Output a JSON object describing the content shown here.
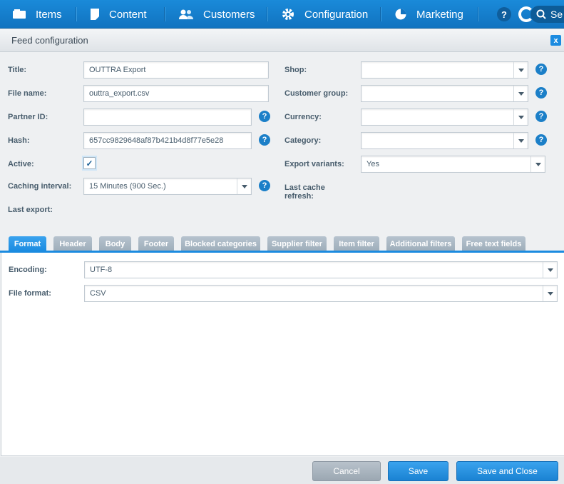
{
  "menu": {
    "items": [
      {
        "label": "Items",
        "icon": "items-icon"
      },
      {
        "label": "Content",
        "icon": "content-icon"
      },
      {
        "label": "Customers",
        "icon": "customers-icon"
      },
      {
        "label": "Configuration",
        "icon": "gear-icon"
      },
      {
        "label": "Marketing",
        "icon": "pie-chart-icon"
      }
    ],
    "help": "?",
    "search_text": "Se"
  },
  "window": {
    "title": "Feed configuration",
    "close": "x"
  },
  "form": {
    "title_label": "Title:",
    "title_value": "OUTTRA Export",
    "filename_label": "File name:",
    "filename_value": "outtra_export.csv",
    "partner_label": "Partner ID:",
    "partner_value": "",
    "hash_label": "Hash:",
    "hash_value": "657cc9829648af87b421b4d8f77e5e28",
    "active_label": "Active:",
    "active_check": "✓",
    "caching_label": "Caching interval:",
    "caching_value": "15 Minutes (900 Sec.)",
    "last_export_label": "Last export:",
    "shop_label": "Shop:",
    "shop_value": "",
    "customer_group_label": "Customer group:",
    "customer_group_value": "",
    "currency_label": "Currency:",
    "currency_value": "",
    "category_label": "Category:",
    "category_value": "",
    "export_variants_label": "Export variants:",
    "export_variants_value": "Yes",
    "last_cache_label_1": "Last cache",
    "last_cache_label_2": "refresh:",
    "help": "?"
  },
  "tabs": [
    "Format",
    "Header",
    "Body",
    "Footer",
    "Blocked categories",
    "Supplier filter",
    "Item filter",
    "Additional filters",
    "Free text fields"
  ],
  "format": {
    "encoding_label": "Encoding:",
    "encoding_value": "UTF-8",
    "file_format_label": "File format:",
    "file_format_value": "CSV"
  },
  "footer": {
    "cancel": "Cancel",
    "save": "Save",
    "save_close": "Save and Close"
  },
  "colors": {
    "accent": "#1b8be0",
    "topbar": "#1173c0",
    "label": "#475c6c"
  }
}
